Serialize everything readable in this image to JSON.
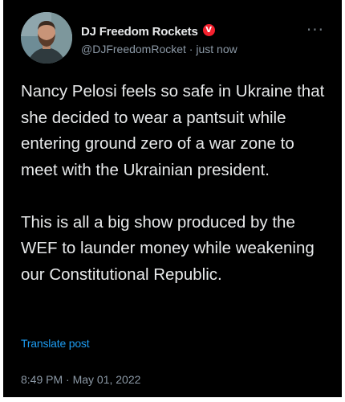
{
  "author": {
    "display_name": "DJ Freedom Rockets",
    "verified_badge_glyph": "V",
    "verified_badge_color": "#f4212e",
    "handle_line": "@DJFreedomRocket · just now"
  },
  "menu": {
    "icon": "more-horizontal-icon",
    "glyph": "···"
  },
  "tweet": {
    "paragraph_1": "Nancy Pelosi feels so safe in Ukraine that she decided to wear a pantsuit while entering ground zero of a war zone to meet with the Ukrainian president.",
    "paragraph_2": "This is all a big show produced by the WEF to launder money while weakening our Constitutional Republic."
  },
  "translate_label": "Translate post",
  "timestamp": "8:49 PM · May 01, 2022",
  "colors": {
    "background": "#000000",
    "text": "#e7e9ea",
    "secondary_text": "#8b98a5",
    "link": "#1d9bf0"
  }
}
